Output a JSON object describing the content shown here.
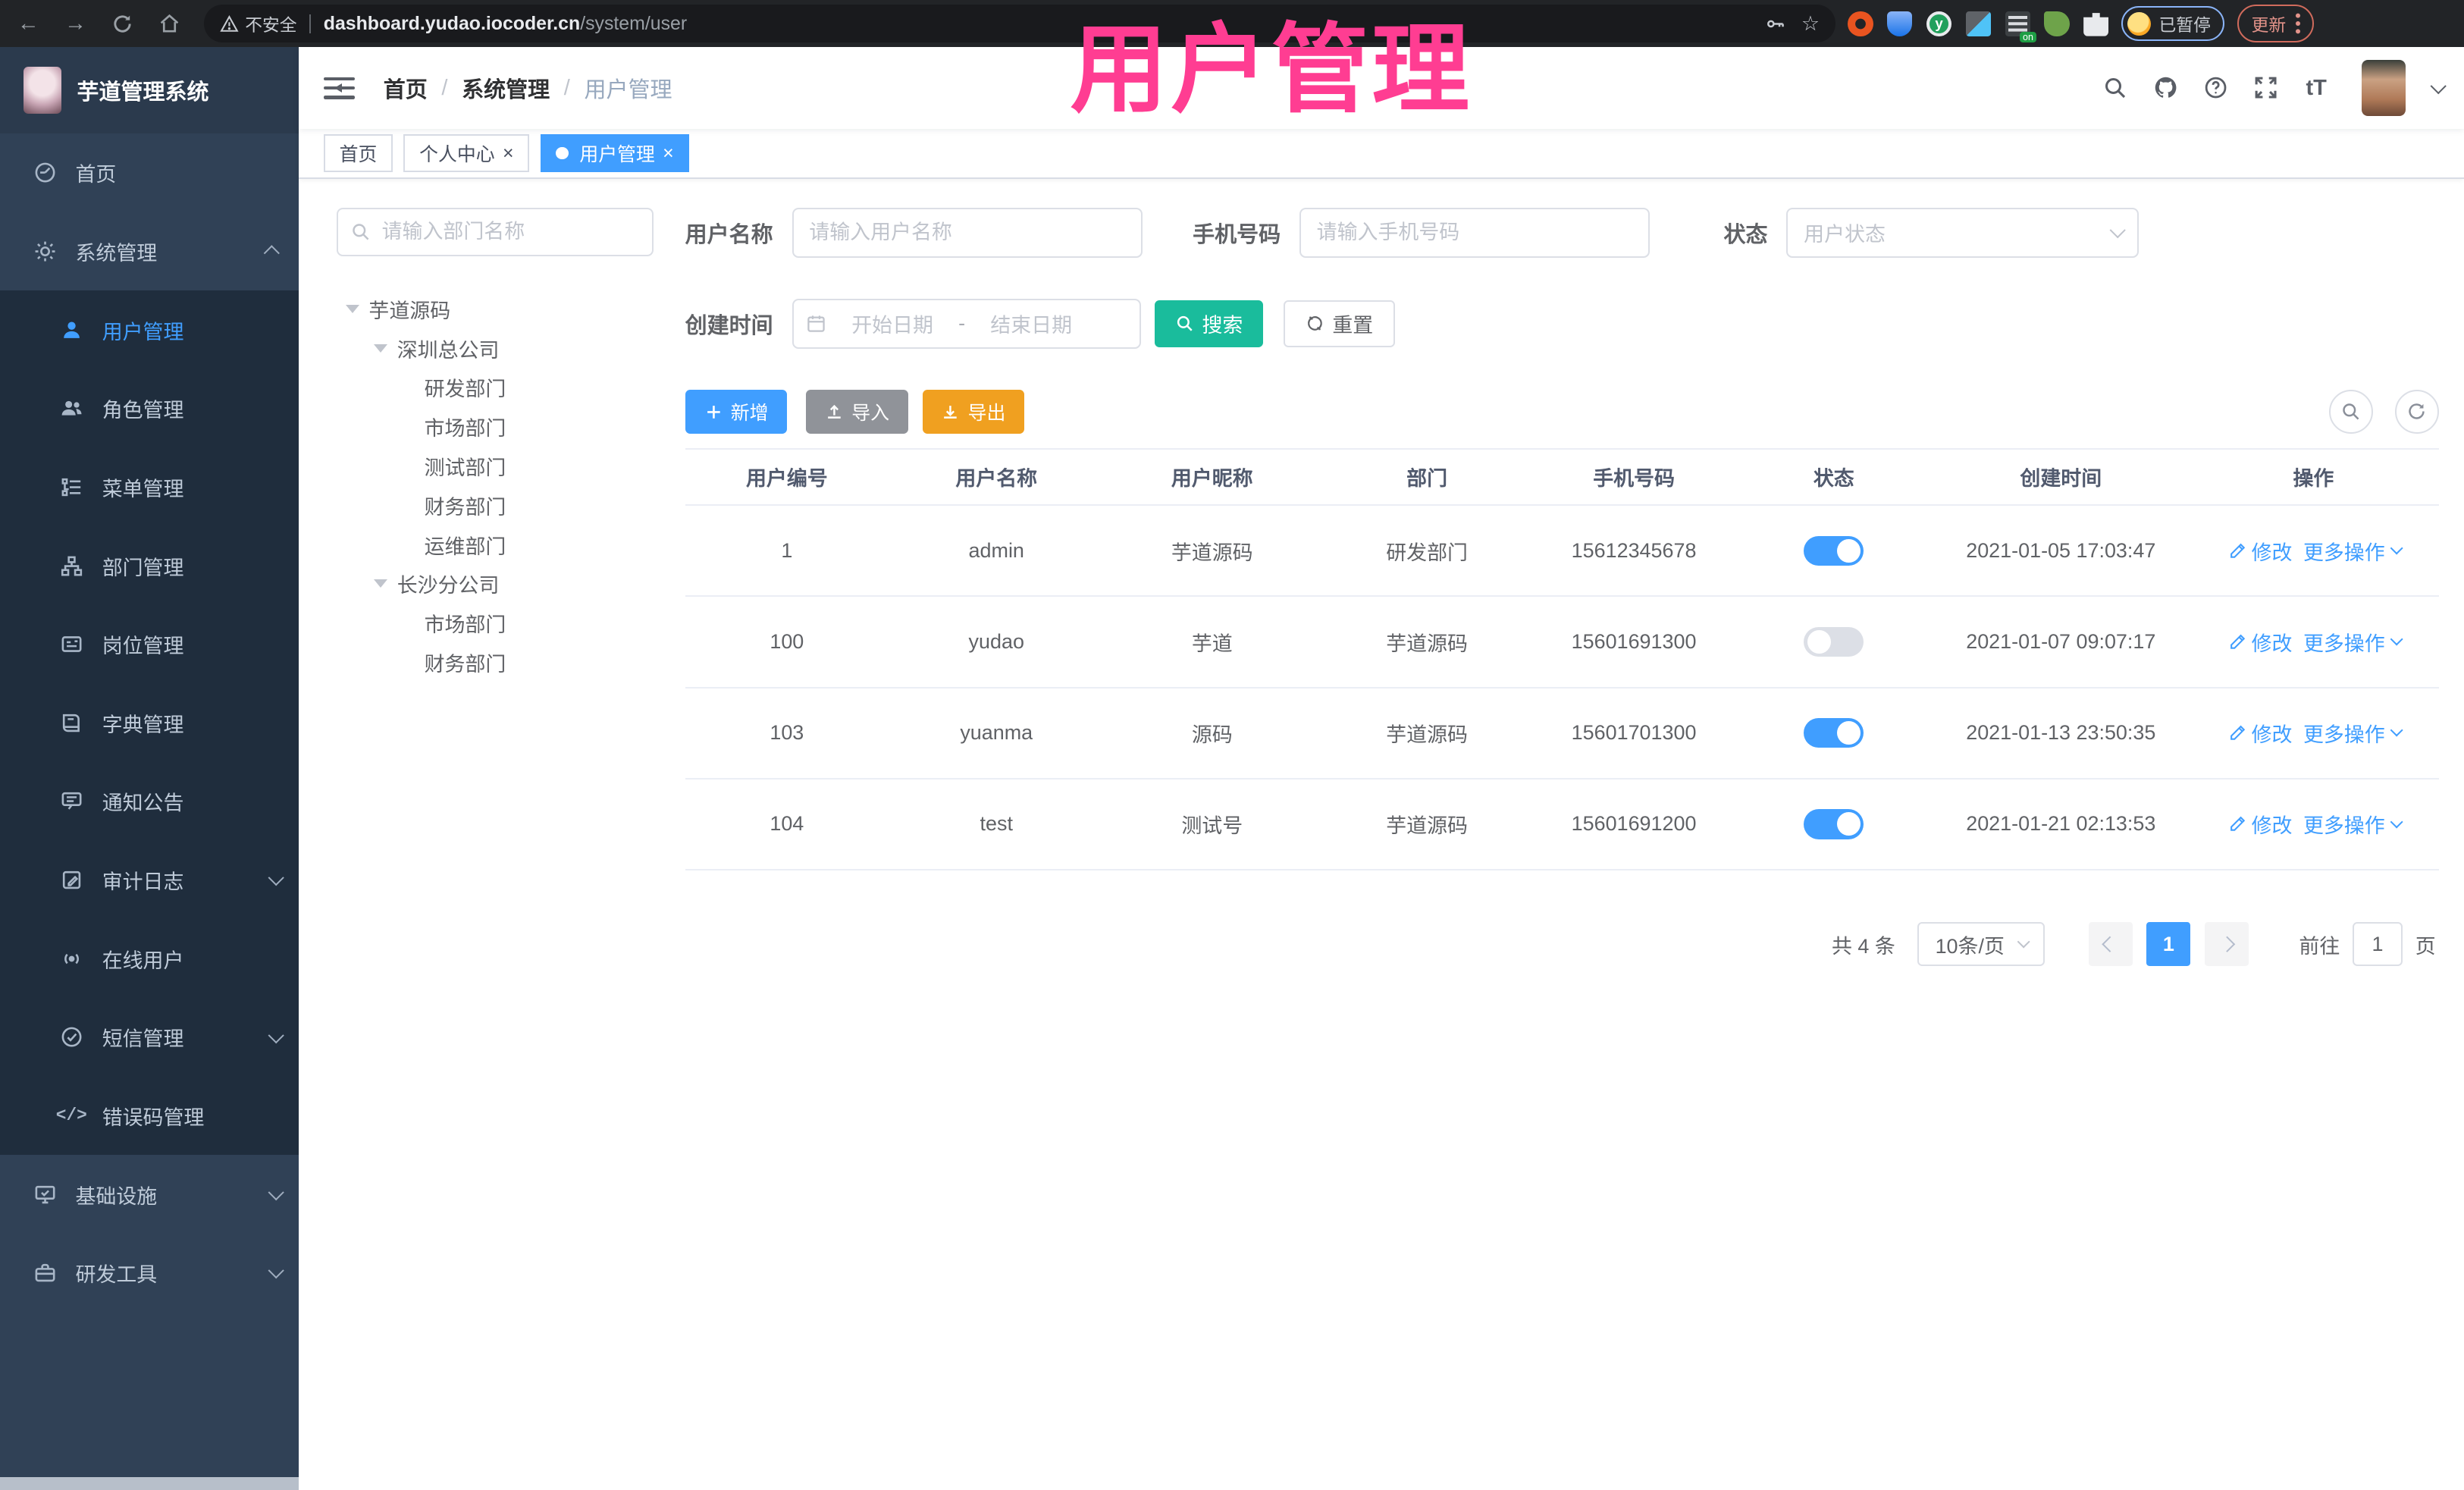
{
  "browser": {
    "security_label": "不安全",
    "url_host": "dashboard.yudao.iocoder.cn",
    "url_path": "/system/user",
    "profile_status": "已暂停",
    "update_label": "更新"
  },
  "annotation": {
    "text": "用户管理",
    "color": "#FF3D92"
  },
  "app": {
    "logo_title": "芋道管理系统",
    "breadcrumb": {
      "sep": "/",
      "items": [
        "首页",
        "系统管理",
        "用户管理"
      ]
    }
  },
  "tabs": [
    {
      "label": "首页"
    },
    {
      "label": "个人中心"
    },
    {
      "label": "用户管理"
    }
  ],
  "icons": {
    "close": "×",
    "font_size": "tT"
  },
  "sidebar": {
    "items": [
      {
        "label": "首页"
      },
      {
        "label": "系统管理"
      },
      {
        "label": "用户管理"
      },
      {
        "label": "角色管理"
      },
      {
        "label": "菜单管理"
      },
      {
        "label": "部门管理"
      },
      {
        "label": "岗位管理"
      },
      {
        "label": "字典管理"
      },
      {
        "label": "通知公告"
      },
      {
        "label": "审计日志"
      },
      {
        "label": "在线用户"
      },
      {
        "label": "短信管理"
      },
      {
        "label": "错误码管理"
      },
      {
        "label": "基础设施"
      },
      {
        "label": "研发工具"
      }
    ],
    "code_icon_glyph": "</>"
  },
  "tree": {
    "search_placeholder": "请输入部门名称",
    "nodes": [
      {
        "label": "芋道源码"
      },
      {
        "label": "深圳总公司"
      },
      {
        "label": "研发部门"
      },
      {
        "label": "市场部门"
      },
      {
        "label": "测试部门"
      },
      {
        "label": "财务部门"
      },
      {
        "label": "运维部门"
      },
      {
        "label": "长沙分公司"
      },
      {
        "label": "市场部门"
      },
      {
        "label": "财务部门"
      }
    ]
  },
  "filters": {
    "username_label": "用户名称",
    "username_placeholder": "请输入用户名称",
    "mobile_label": "手机号码",
    "mobile_placeholder": "请输入手机号码",
    "status_label": "状态",
    "status_placeholder": "用户状态",
    "created_label": "创建时间",
    "date_start_placeholder": "开始日期",
    "date_separator": "-",
    "date_end_placeholder": "结束日期",
    "search_label": "搜索",
    "reset_label": "重置"
  },
  "toolbar": {
    "add_label": "新增",
    "import_label": "导入",
    "export_label": "导出"
  },
  "table": {
    "columns": [
      "用户编号",
      "用户名称",
      "用户昵称",
      "部门",
      "手机号码",
      "状态",
      "创建时间",
      "操作"
    ],
    "ops": {
      "edit": "修改",
      "more": "更多操作"
    },
    "rows": [
      {
        "id": "1",
        "username": "admin",
        "nickname": "芋道源码",
        "dept": "研发部门",
        "mobile": "15612345678",
        "status": "on",
        "created": "2021-01-05 17:03:47"
      },
      {
        "id": "100",
        "username": "yudao",
        "nickname": "芋道",
        "dept": "芋道源码",
        "mobile": "15601691300",
        "status": "off",
        "created": "2021-01-07 09:07:17"
      },
      {
        "id": "103",
        "username": "yuanma",
        "nickname": "源码",
        "dept": "芋道源码",
        "mobile": "15601701300",
        "status": "on",
        "created": "2021-01-13 23:50:35"
      },
      {
        "id": "104",
        "username": "test",
        "nickname": "测试号",
        "dept": "芋道源码",
        "mobile": "15601691200",
        "status": "on",
        "created": "2021-01-21 02:13:53"
      }
    ]
  },
  "pagination": {
    "total": "共 4 条",
    "page_size": "10条/页",
    "current_page": "1",
    "goto_label": "前往",
    "goto_value": "1",
    "page_unit": "页"
  },
  "colors": {
    "accent": "#409EFF",
    "search_teal": "#1ABC9C",
    "export_orange": "#F0A020",
    "import_gray": "#909399",
    "annotation_pink": "#FF3D92"
  }
}
